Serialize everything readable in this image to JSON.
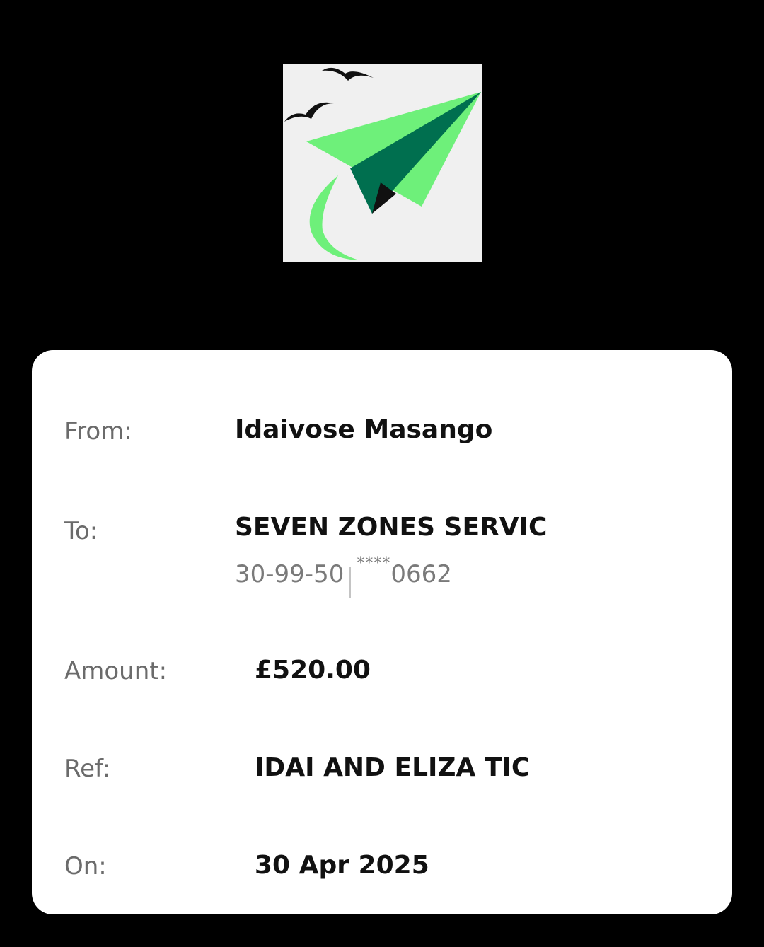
{
  "logo": {
    "icon": "paper-plane-with-birds-logo",
    "background": "#f0f0f0",
    "colors": {
      "plane_light": "#6ef07a",
      "plane_dark": "#006f4f",
      "birds": "#111111"
    }
  },
  "details": {
    "from": {
      "label": "From:",
      "value": "Idaivose Masango"
    },
    "to": {
      "label": "To:",
      "value": "SEVEN ZONES SERVIC",
      "sort_code": "30-99-50",
      "account_mask": "****",
      "account_last4": "0662"
    },
    "amount": {
      "label": "Amount:",
      "value": "£520.00"
    },
    "ref": {
      "label": "Ref:",
      "value": "IDAI AND ELIZA TIC"
    },
    "on": {
      "label": "On:",
      "value": "30 Apr 2025"
    }
  }
}
